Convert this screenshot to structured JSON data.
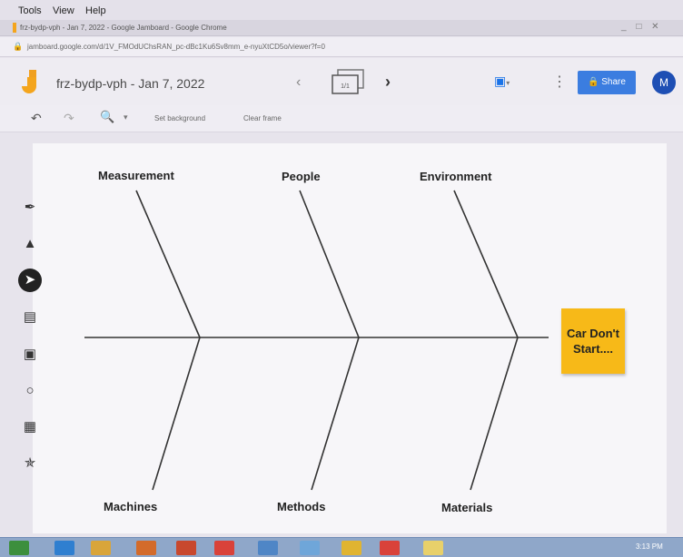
{
  "menubar": {
    "items": [
      "Tools",
      "View",
      "Help"
    ]
  },
  "browser": {
    "tab_title": "frz-bydp-vph - Jan 7, 2022 - Google Jamboard - Google Chrome",
    "window_controls": "_ □ ✕",
    "url": "jamboard.google.com/d/1V_FMOdUChsRAN_pc-dBc1Ku6Sv8mm_e-nyuXtCD5o/viewer?f=0"
  },
  "header": {
    "doc_title": "frz-bydp-vph - Jan 7, 2022",
    "frame_counter": "1/1",
    "share_label": "Share",
    "avatar_initial": "M"
  },
  "toolbar": {
    "set_background": "Set background",
    "clear_frame": "Clear frame"
  },
  "tools": [
    "pen-icon",
    "eraser-icon",
    "select-icon",
    "sticky-note-icon",
    "image-icon",
    "circle-icon",
    "text-box-icon",
    "laser-icon"
  ],
  "diagram": {
    "top_labels": [
      "Measurement",
      "People",
      "Environment"
    ],
    "bottom_labels": [
      "Machines",
      "Methods",
      "Materials"
    ],
    "effect": "Car Don't Start....",
    "colors": {
      "sticky": "#f7b918",
      "lines": "#333333"
    }
  },
  "taskbar": {
    "clock": "3:13 PM"
  }
}
